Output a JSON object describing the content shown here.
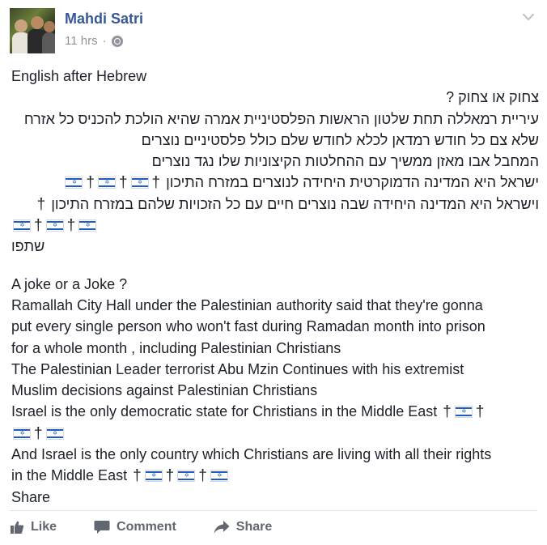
{
  "post": {
    "author": "Mahdi Satri",
    "timestamp": "11 hrs",
    "privacy_icon": "globe-icon",
    "menu_icon": "chevron-down-icon"
  },
  "content": {
    "intro": "English after Hebrew",
    "hebrew_title": "צחוק או צחוק ?",
    "hebrew_lines": [
      "עיריית רמאללה תחת שלטון הראשות הפלסטיניית אמרה שהיא הולכת להכניס כל אזרח",
      "שלא צם כל חודש רמדאן לכלא לחודש שלם כולל פלסטיניים נוצרים",
      "המחבל אבו מאזן ממשיך עם ההחלטות הקיצוניות שלו נגד נוצרים",
      "ישראל היא המדינה הדמוקרטית היחידה לנוצרים במזרח התיכון",
      "וישראל היא המדינה היחידה שבה נוצרים חיים עם כל הזכויות שלהם במזרח התיכון"
    ],
    "hebrew_share": "שתפו",
    "english_title": "A joke or a Joke ?",
    "english_lines": [
      "Ramallah City Hall under the Palestinian authority said that they're gonna",
      "put every single person who won't fast during Ramadan month into prison",
      "for a whole month , including Palestinian Christians",
      "The Palestinian Leader terrorist Abu Mzin Continues with his extremist",
      "Muslim decisions against Palestinian Christians",
      "Israel is the only democratic state for Christians in the Middle East",
      "And Israel is the only country which Christians are living with all their rights",
      "in the Middle East"
    ],
    "english_share": "Share",
    "cross_glyph": "†"
  },
  "actions": {
    "like": "Like",
    "comment": "Comment",
    "share": "Share"
  },
  "colors": {
    "author": "#365899",
    "meta": "#90949c",
    "text": "#1d2129",
    "action": "#616770",
    "flag_blue": "#1e5bc6"
  }
}
